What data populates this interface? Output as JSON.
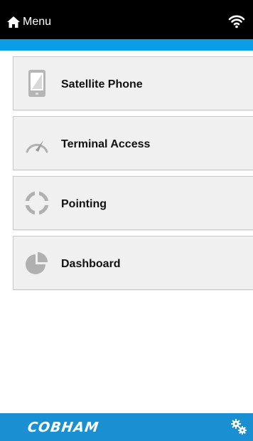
{
  "header": {
    "menu_label": "Menu",
    "home_icon": "home-icon",
    "wifi_icon": "wifi-icon"
  },
  "menu": {
    "items": [
      {
        "label": "Satellite Phone",
        "icon": "phone-icon"
      },
      {
        "label": "Terminal Access",
        "icon": "speedometer-icon"
      },
      {
        "label": "Pointing",
        "icon": "crosshair-icon"
      },
      {
        "label": "Dashboard",
        "icon": "pie-chart-icon"
      }
    ]
  },
  "footer": {
    "logo": "COBHAM",
    "settings_icon": "gears-icon"
  },
  "colors": {
    "header_bg": "#000000",
    "accent": "#0a9ee6",
    "footer_bg": "#1a8fd2",
    "icon_gray": "#b0b0b0"
  }
}
